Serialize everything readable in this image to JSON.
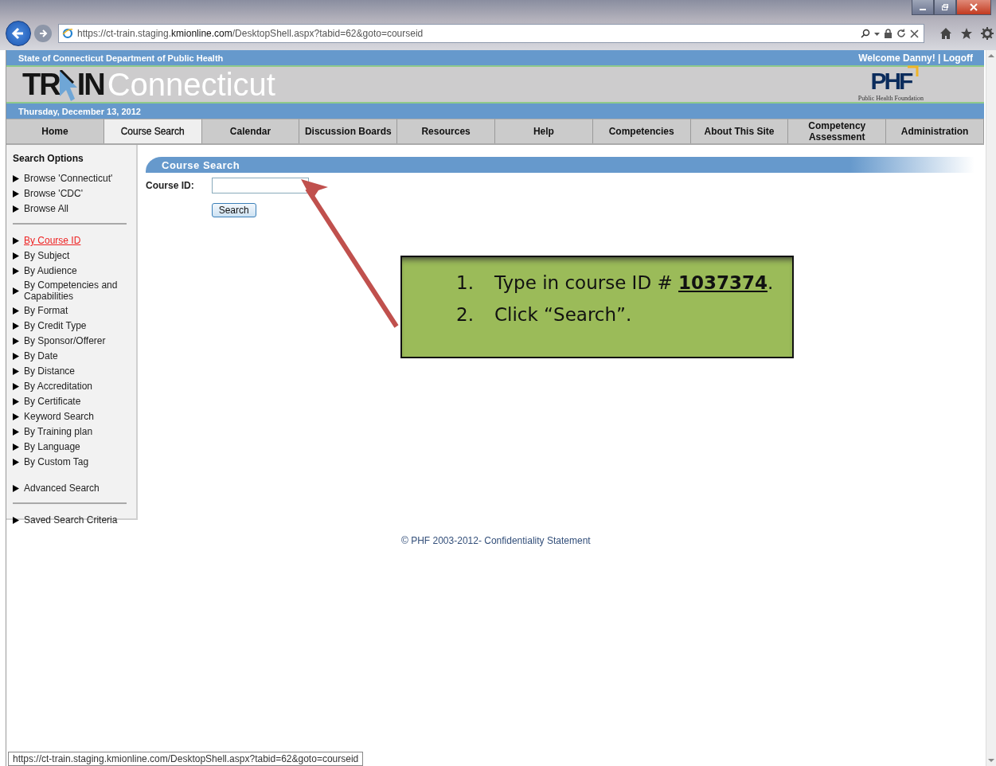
{
  "browser": {
    "url": "https://ct-train.staging.**kmionline.com**/DesktopShell.aspx?tabid=62&goto=courseid",
    "status_url": "https://ct-train.staging.kmionline.com/DesktopShell.aspx?tabid=62&goto=courseid"
  },
  "header": {
    "agency": "State of Connecticut Department of Public Health",
    "welcome": "Welcome Danny!",
    "separator": "|",
    "logoff": "Logoff",
    "logo": {
      "part_1": "TR",
      "part_2": "IN",
      "state": "Connecticut"
    },
    "partner_logo": {
      "letters": "PHF",
      "caption": "Public Health Foundation"
    },
    "date": "Thursday, December 13, 2012"
  },
  "tabs": [
    {
      "label": "Home",
      "selected": false
    },
    {
      "label": "Course Search",
      "selected": true
    },
    {
      "label": "Calendar",
      "selected": false
    },
    {
      "label": "Discussion Boards",
      "selected": false
    },
    {
      "label": "Resources",
      "selected": false
    },
    {
      "label": "Help",
      "selected": false
    },
    {
      "label": "Competencies",
      "selected": false
    },
    {
      "label": "About This Site",
      "selected": false
    },
    {
      "label": "Competency Assessment",
      "selected": false
    },
    {
      "label": "Administration",
      "selected": false
    }
  ],
  "sidebar": {
    "title": "Search Options",
    "groups": [
      [
        {
          "label": "Browse 'Connecticut'",
          "selected": false
        },
        {
          "label": "Browse 'CDC'",
          "selected": false
        },
        {
          "label": "Browse All",
          "selected": false
        }
      ],
      [
        {
          "label": "By Course ID",
          "selected": true
        },
        {
          "label": "By Subject",
          "selected": false
        },
        {
          "label": "By Audience",
          "selected": false
        },
        {
          "label": "By Competencies and Capabilities",
          "selected": false
        },
        {
          "label": "By Format",
          "selected": false
        },
        {
          "label": "By Credit Type",
          "selected": false
        },
        {
          "label": "By Sponsor/Offerer",
          "selected": false
        },
        {
          "label": "By Date",
          "selected": false
        },
        {
          "label": "By Distance",
          "selected": false
        },
        {
          "label": "By Accreditation",
          "selected": false
        },
        {
          "label": "By Certificate",
          "selected": false
        },
        {
          "label": "Keyword Search",
          "selected": false
        },
        {
          "label": "By Training plan",
          "selected": false
        },
        {
          "label": "By Language",
          "selected": false
        },
        {
          "label": "By Custom Tag",
          "selected": false
        },
        {
          "label": "Advanced Search",
          "selected": false,
          "gap_before": true
        }
      ],
      [
        {
          "label": "Saved Search Criteria",
          "selected": false
        }
      ]
    ]
  },
  "main": {
    "title": "Course Search",
    "field_label": "Course ID:",
    "button": "Search"
  },
  "callout": {
    "steps": [
      {
        "number": "1.",
        "text": "Type in course ID # **1037374**."
      },
      {
        "number": "2.",
        "text": "Click “Search”."
      }
    ]
  },
  "footer": "© PHF 2003-2012- Confidentiality Statement"
}
